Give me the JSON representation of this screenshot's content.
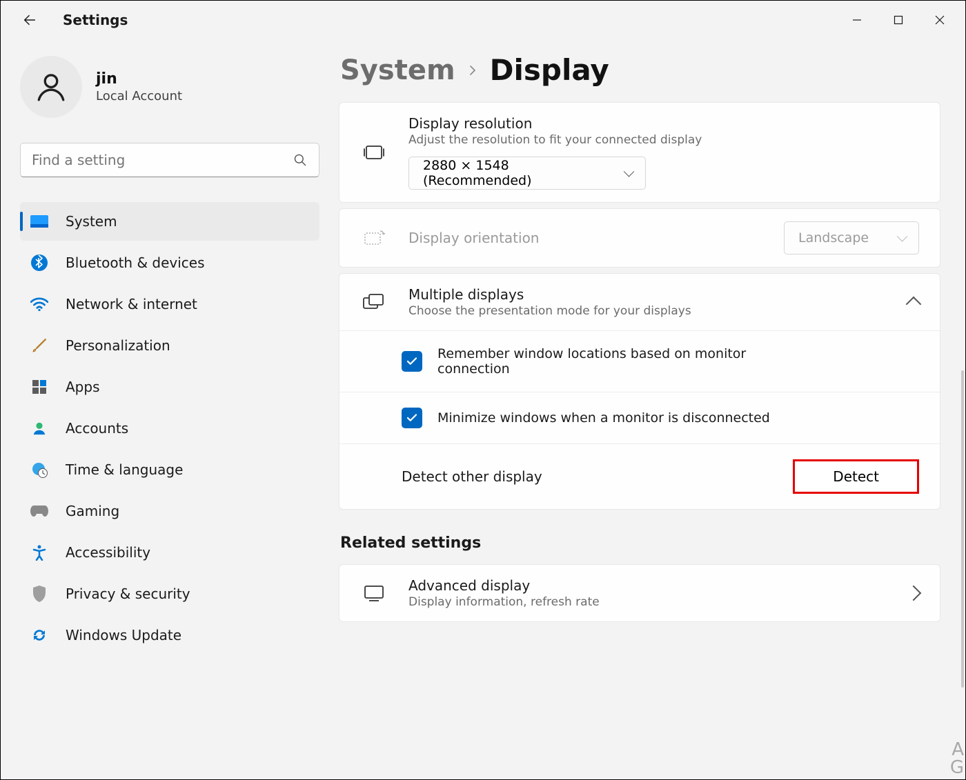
{
  "app_title": "Settings",
  "user": {
    "name": "jin",
    "subtitle": "Local Account"
  },
  "search": {
    "placeholder": "Find a setting"
  },
  "nav": {
    "items": [
      {
        "label": "System"
      },
      {
        "label": "Bluetooth & devices"
      },
      {
        "label": "Network & internet"
      },
      {
        "label": "Personalization"
      },
      {
        "label": "Apps"
      },
      {
        "label": "Accounts"
      },
      {
        "label": "Time & language"
      },
      {
        "label": "Gaming"
      },
      {
        "label": "Accessibility"
      },
      {
        "label": "Privacy & security"
      },
      {
        "label": "Windows Update"
      }
    ]
  },
  "breadcrumb": {
    "root": "System",
    "leaf": "Display"
  },
  "resolution": {
    "title": "Display resolution",
    "sub": "Adjust the resolution to fit your connected display",
    "value": "2880 × 1548 (Recommended)"
  },
  "orientation": {
    "title": "Display orientation",
    "value": "Landscape"
  },
  "multiple": {
    "title": "Multiple displays",
    "sub": "Choose the presentation mode for your displays",
    "opt_remember": "Remember window locations based on monitor connection",
    "opt_minimize": "Minimize windows when a monitor is disconnected",
    "detect_label": "Detect other display",
    "detect_btn": "Detect"
  },
  "related": {
    "header": "Related settings",
    "adv_title": "Advanced display",
    "adv_sub": "Display information, refresh rate"
  },
  "lang_indicator": "A\nG"
}
